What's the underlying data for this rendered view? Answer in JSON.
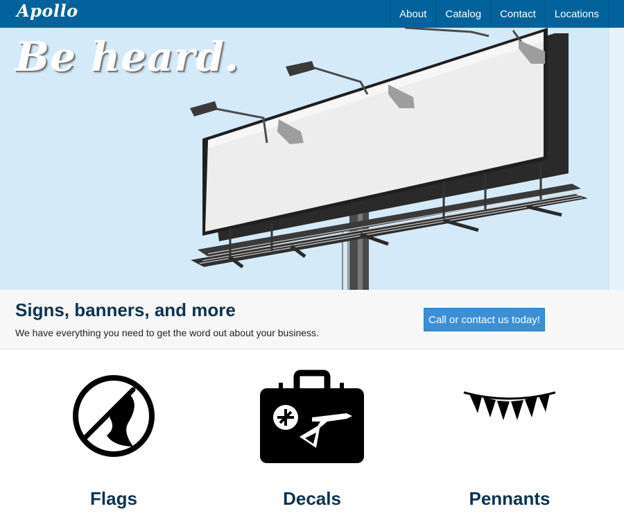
{
  "nav": {
    "brand": "Apollo",
    "links": [
      "About",
      "Catalog",
      "Contact",
      "Locations"
    ]
  },
  "hero": {
    "title": "Be heard."
  },
  "callout": {
    "title": "Signs, banners, and more",
    "text": "We have everything you need to get the word out about your business.",
    "button": "Call or contact us today!"
  },
  "products": [
    {
      "title": "Flags",
      "icon": "flag-icon"
    },
    {
      "title": "Decals",
      "icon": "suitcase-icon"
    },
    {
      "title": "Pennants",
      "icon": "pennant-icon"
    }
  ],
  "colors": {
    "navbar": "#02639c",
    "hero_sky": "#d5eaf9",
    "heading": "#0d3350",
    "button": "#3c8fd4"
  }
}
